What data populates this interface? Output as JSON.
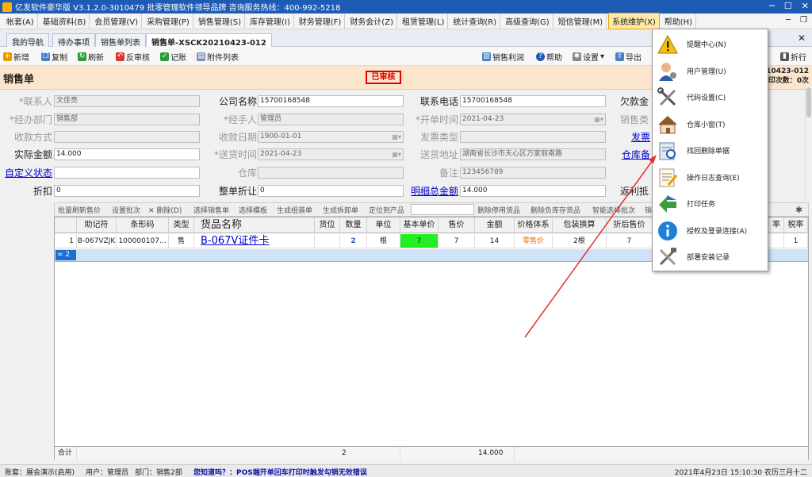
{
  "window": {
    "title": "亿发软件豪华版 V3.1.2.0-3010479 批零管理软件领导品牌 咨询服务热线：400-992-5218"
  },
  "menubar": {
    "items": [
      "帐套(A)",
      "基础资料(B)",
      "会员管理(V)",
      "采购管理(P)",
      "销售管理(S)",
      "库存管理(I)",
      "财务管理(F)",
      "财务会计(Z)",
      "租赁管理(L)",
      "统计查询(R)",
      "高级查询(G)",
      "短信管理(M)",
      "系统维护(X)",
      "帮助(H)"
    ],
    "active_index": 12
  },
  "tabs": {
    "items": [
      "我的导航",
      "待办事项",
      "销售单列表",
      "销售单-XSCK20210423-012"
    ],
    "active_index": 3
  },
  "toolbar": {
    "new": "新增",
    "copy": "复制",
    "refresh": "刷新",
    "unaudit": "反审核",
    "post": "记账",
    "attachments": "附件列表",
    "sales_profit": "销售利润",
    "help": "帮助",
    "settings": "设置",
    "export": "导出",
    "wrap": "折行"
  },
  "header": {
    "title": "销售单",
    "stamp": "已审核",
    "doc_no": "210423-012",
    "print_count": "印次数：0次"
  },
  "form": {
    "contact_label": "*联系人",
    "contact": "文佳亮",
    "company_label": "公司名称",
    "company": "15700168548",
    "phone_label": "联系电话",
    "phone": "15700168548",
    "owed_label": "欠款金",
    "dept_label": "*经办部门",
    "dept": "销售部",
    "handler_label": "*经手人",
    "handler": "管理员",
    "open_date_label": "*开单时间",
    "open_date": "2021-04-23",
    "sales_type_label": "销售类",
    "pay_method_label": "收款方式",
    "pay_date_label": "收款日期",
    "pay_date": "1900-01-01",
    "invoice_type_label": "发票类型",
    "invoice_label": "发票",
    "actual_amount_label": "实际金额",
    "actual_amount": "14.000",
    "delivery_date_label": "*送货时间",
    "delivery_date": "2021-04-23",
    "delivery_addr_label": "送货地址",
    "delivery_addr": "湖南省长沙市天心区万家丽南路",
    "warehouse_remark_label": "仓库备",
    "custom_status_label": "自定义状态",
    "warehouse_label": "仓库",
    "remark_label": "备注",
    "remark": "123456789",
    "discount_label": "折扣",
    "discount": "0",
    "whole_discount_label": "整单折让",
    "whole_discount": "0",
    "detail_total_label": "明细总金额",
    "detail_total": "14.000",
    "rebate_label": "返利抵"
  },
  "gridbar": {
    "items": [
      "批量刷新售价",
      "设置批次",
      "删除(D)",
      "选择销售单",
      "选择模板",
      "生成组装单",
      "生成拆卸单",
      "定位到产品",
      "删除停用货品",
      "删除负库存货品",
      "智能选择批次",
      "销"
    ]
  },
  "grid": {
    "headers": [
      "",
      "助记符",
      "条形码",
      "类型",
      "货品名称",
      "货位",
      "数量",
      "单位",
      "基本单价",
      "售价",
      "金额",
      "价格体系",
      "包装换算",
      "折后售价",
      "率",
      "税率"
    ],
    "row": {
      "no": "1",
      "code": "B-067VZJK",
      "barcode": "100000107...",
      "type": "售",
      "name": "B-067V证件卡",
      "location": "",
      "qty": "2",
      "unit": "根",
      "base_price": "7",
      "price": "7",
      "amount": "14",
      "price_system": "零售价",
      "pack": "2根",
      "discount_price": "7",
      "rate": "",
      "tax": "1"
    },
    "new_row_no": "2",
    "footer": {
      "label": "合计",
      "qty": "2",
      "amount": "14.000"
    }
  },
  "dropdown": {
    "items": [
      {
        "label": "提醒中心(N)",
        "icon": "warning-icon"
      },
      {
        "label": "用户管理(U)",
        "icon": "user-icon"
      },
      {
        "label": "代码设置(C)",
        "icon": "tools-icon"
      },
      {
        "label": "仓库小窗(T)",
        "icon": "house-icon"
      },
      {
        "label": "找回删除单据",
        "icon": "recover-doc-icon"
      },
      {
        "label": "操作日志查询(E)",
        "icon": "log-icon"
      },
      {
        "label": "打印任务",
        "icon": "print-task-icon"
      },
      {
        "label": "授权及登录连接(A)",
        "icon": "info-icon"
      },
      {
        "label": "部署安装记录",
        "icon": "deploy-tools-icon"
      }
    ]
  },
  "statusbar": {
    "account": "账套：展会演示(启用)",
    "user": "用户：管理员",
    "dept": "部门：销售2部",
    "tip": "您知道吗？：POS端开单回车打印时触发勾销无效错误",
    "datetime": "2021年4月23日  15:10:30  农历三月十二"
  },
  "colors": {
    "title_bar": "#1e5bb5",
    "header_band": "#fbe6cd",
    "stamp_red": "#dd0000",
    "base_price_cell": "#22ee22",
    "annotation_arrow": "#e03030",
    "link_blue": "#0000cc"
  }
}
